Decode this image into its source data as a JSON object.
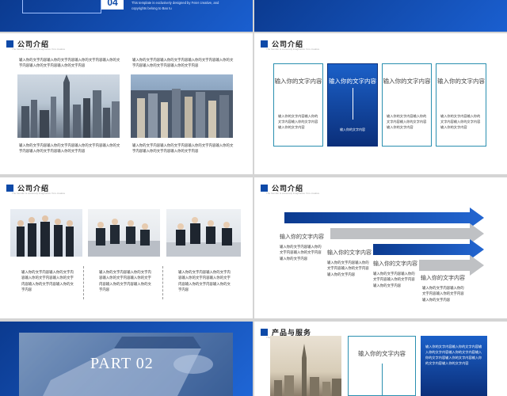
{
  "slide1": {
    "number": "04",
    "tagline": "This template is exclusively designed by Feier creative, and copyrights belong to Bao tu"
  },
  "slide3": {
    "title": "公司介绍",
    "subtitle": "The founder is extremely imaginative Yoru creative",
    "left_top": "输入你的文字内容输入你的文字内容输入你的文字内容输入你的文字内容输入你的文字内容输入你的文字内容",
    "right_top": "输入你的文字内容输入你的文字内容输入你的文字内容输入你的文字内容输入你的文字内容输入你的文字内容",
    "left_bottom": "输入你的文字内容输入你的文字内容输入你的文字内容输入你的文字内容输入你的文字内容输入你的文字内容",
    "right_bottom": "输入你的文字内容输入你的文字内容输入你的文字内容输入你的文字内容输入你的文字内容输入你的文字内容"
  },
  "slide4": {
    "title": "公司介绍",
    "subtitle": "The founder is extremely imaginative Yoru creative",
    "boxes": [
      {
        "heading": "输入你的文字内容",
        "body": "输入你的文字内容输入你的文字内容输入你的文字内容输入你的文字内容"
      },
      {
        "heading": "输入你的文字内容",
        "body": "输入你的文字内容"
      },
      {
        "heading": "输入你的文字内容",
        "body": "输入你的文字内容输入你的文字内容输入你的文字内容输入你的文字内容"
      },
      {
        "heading": "输入你的文字内容",
        "body": "输入你的文字内容输入你的文字内容输入你的文字内容输入你的文字内容"
      }
    ]
  },
  "slide5": {
    "title": "公司介绍",
    "subtitle": "The founder is extremely imaginative Yoru creative",
    "cols": [
      "输入你的文字内容输入你的文字内容输入你的文字内容输入你的文字内容输入你的文字内容输入你的文字内容",
      "输入你的文字内容输入你的文字内容输入你的文字内容输入你的文字内容输入你的文字内容输入你的文字内容",
      "输入你的文字内容输入你的文字内容输入你的文字内容输入你的文字内容输入你的文字内容输入你的文字内容"
    ]
  },
  "slide6": {
    "title": "公司介绍",
    "subtitle": "The founder is extremely imaginative Yoru creative",
    "steps": [
      {
        "heading": "输入你的文字内容",
        "body": "输入你的文字内容输入你的文字内容输入你的文字内容输入你的文字内容"
      },
      {
        "heading": "输入你的文字内容",
        "body": "输入你的文字内容输入你的文字内容输入你的文字内容输入你的文字内容"
      },
      {
        "heading": "输入你的文字内容",
        "body": "输入你的文字内容输入你的文字内容输入你的文字内容输入你的文字内容"
      },
      {
        "heading": "输入你的文字内容",
        "body": "输入你的文字内容输入你的文字内容输入你的文字内容输入你的文字内容"
      }
    ]
  },
  "slide7": {
    "part": "PART  02"
  },
  "slide8": {
    "title": "产品与服务",
    "subtitle": "The founder is extremely imaginative Yoru creative",
    "box_heading": "输入你的文字内容",
    "dark_text": "输入你的文字内容输入你的文字内容输入你的文字内容输入你的文字内容输入你的文字内容输入你的文字内容输入你的文字内容输入你的文字内容"
  }
}
